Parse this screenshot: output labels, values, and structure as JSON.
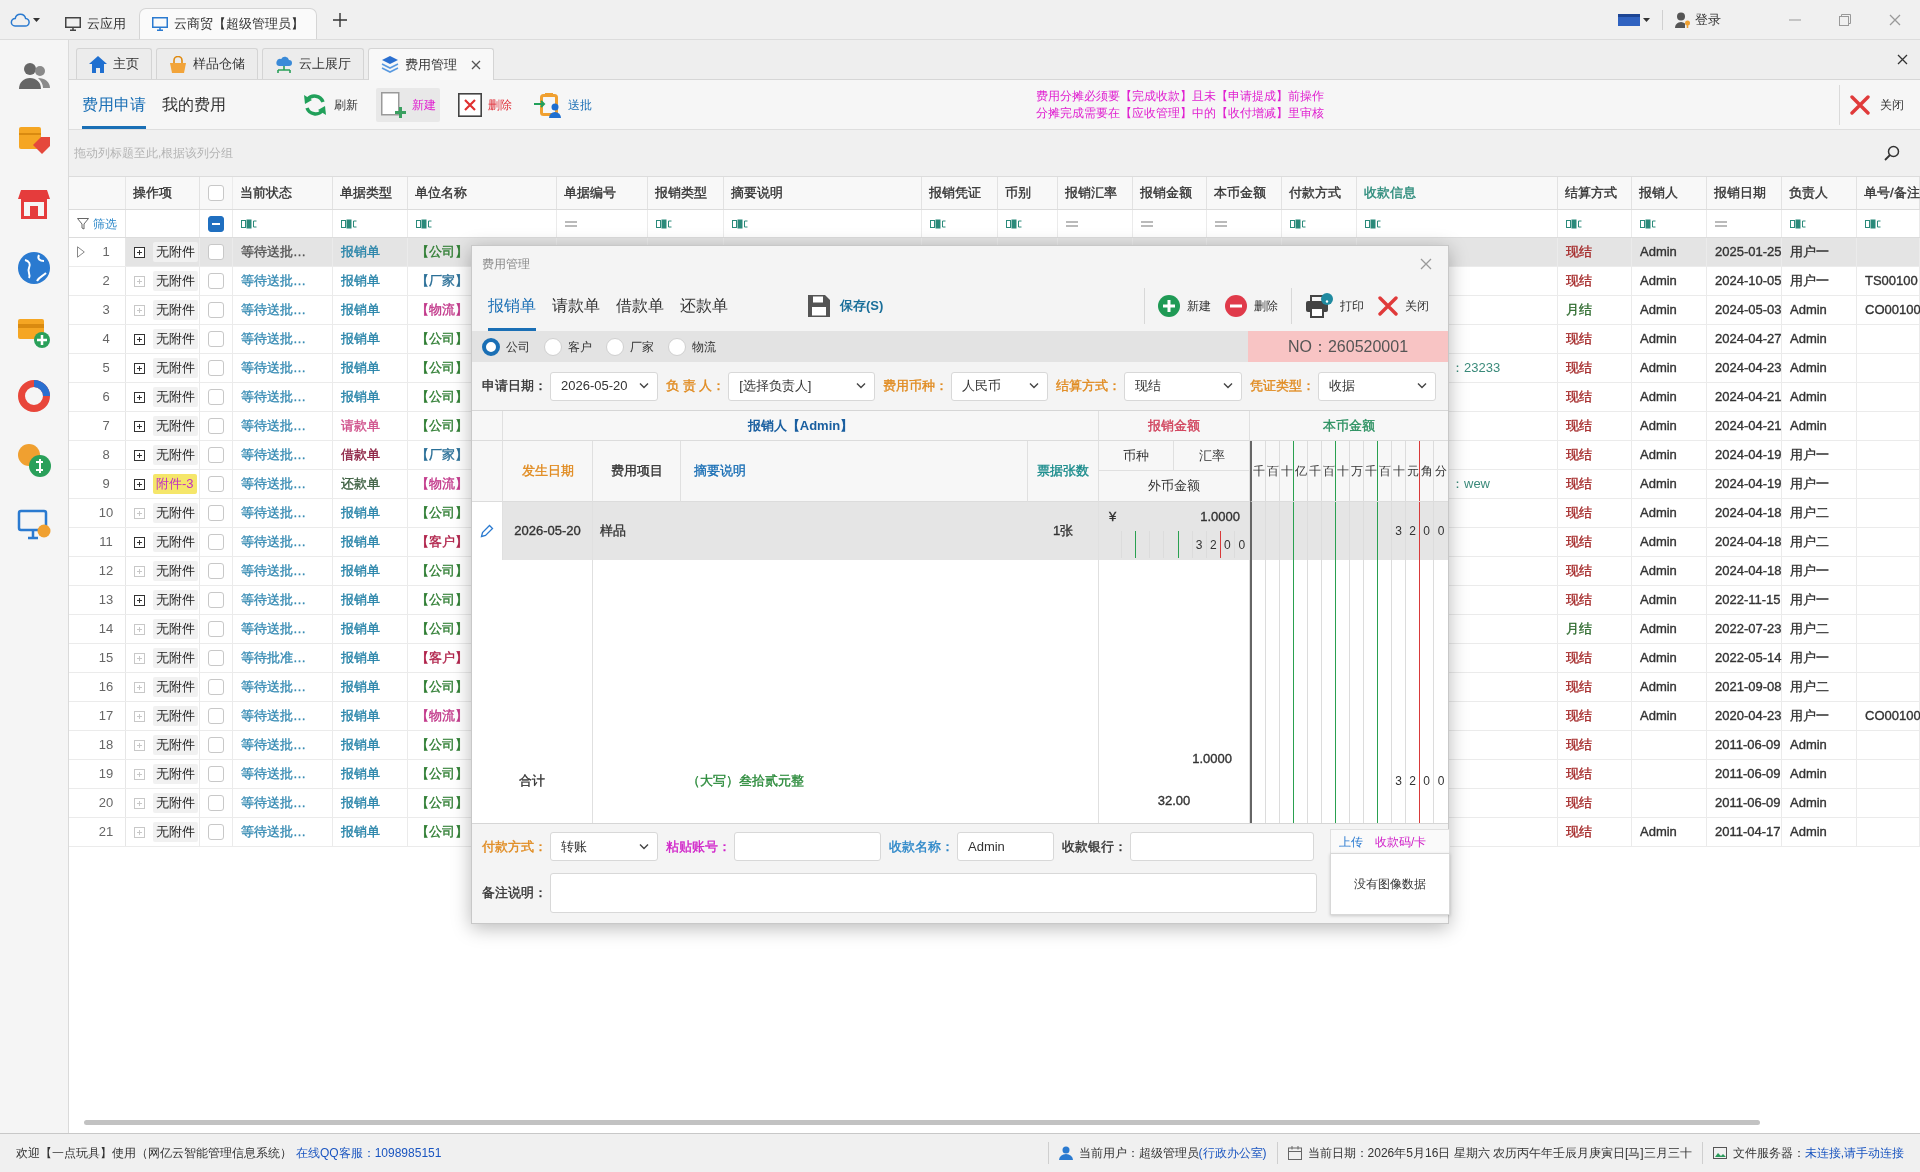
{
  "titlebar": {
    "tabs": [
      {
        "label": "云应用",
        "selected": false
      },
      {
        "label": "云商贸【超级管理员】",
        "selected": true
      }
    ],
    "login": "登录"
  },
  "module_tabs": [
    {
      "kind": "home",
      "label": "主页",
      "selected": false
    },
    {
      "kind": "warehouse",
      "label": "样品仓储",
      "selected": false
    },
    {
      "kind": "showroom",
      "label": "云上展厅",
      "selected": false
    },
    {
      "kind": "expense",
      "label": "费用管理",
      "selected": true
    }
  ],
  "toolbar": {
    "views": [
      {
        "label": "费用申请",
        "selected": true
      },
      {
        "label": "我的费用",
        "selected": false
      }
    ],
    "buttons": [
      {
        "kind": "refresh",
        "label": "刷新",
        "hovered": false
      },
      {
        "kind": "new",
        "label": "新建",
        "hovered": true
      },
      {
        "kind": "delete",
        "label": "删除",
        "hovered": false
      },
      {
        "kind": "submit",
        "label": "送批",
        "hovered": false
      }
    ],
    "notice": [
      "费用分摊必须要【完成收款】且未【申请提成】前操作",
      "分摊完成需要在【应收管理】中的【收付增减】里审核"
    ],
    "close": "关闭"
  },
  "table": {
    "group_hint": "拖动列标题至此,根据该列分组",
    "filter_label": "筛选",
    "select_all": {
      "checked": false
    },
    "filter_select": {
      "indeterminate": true
    },
    "columns": [
      {
        "label": "操作项"
      },
      {
        "label": "当前状态",
        "kind": "text"
      },
      {
        "label": "单据类型",
        "kind": "text"
      },
      {
        "label": "单位名称",
        "kind": "text"
      },
      {
        "label": "单据编号",
        "kind": "equals"
      },
      {
        "label": "报销类型",
        "kind": "text"
      },
      {
        "label": "摘要说明",
        "kind": "text"
      },
      {
        "label": "报销凭证",
        "kind": "text"
      },
      {
        "label": "币别",
        "kind": "text"
      },
      {
        "label": "报销汇率",
        "kind": "equals"
      },
      {
        "label": "报销金额",
        "kind": "equals"
      },
      {
        "label": "本币金额",
        "kind": "equals"
      },
      {
        "label": "付款方式",
        "kind": "text"
      },
      {
        "label": "收款信息",
        "kind": "text",
        "color": "#2a8a7a"
      },
      {
        "label": "结算方式",
        "kind": "text"
      },
      {
        "label": "报销人",
        "kind": "text"
      },
      {
        "label": "报销日期",
        "kind": "equals"
      },
      {
        "label": "负责人",
        "kind": "text"
      },
      {
        "label": "单号/备注",
        "kind": "text"
      }
    ],
    "rows": [
      {
        "no": "1",
        "selected": true,
        "expandable": true,
        "checked": false,
        "attachment": {
          "text": "无附件",
          "highlighted": false
        },
        "status": "等待送批…",
        "doc_type": {
          "text": "报销单",
          "color": "#2683a8"
        },
        "party": {
          "text": "【公司】",
          "color": "#2e7d32"
        },
        "settlement": {
          "text": "现结",
          "color": "#a52a2a"
        },
        "claimant": "Admin",
        "date": "2025-01-25",
        "owner": "用户一"
      },
      {
        "no": "2",
        "selected": false,
        "expandable": false,
        "checked": false,
        "attachment": {
          "text": "无附件",
          "highlighted": false
        },
        "status": "等待送批…",
        "doc_type": {
          "text": "报销单",
          "color": "#2683a8"
        },
        "party": {
          "text": "【厂家】",
          "color": "#2a6f97"
        },
        "settlement": {
          "text": "现结",
          "color": "#a52a2a"
        },
        "claimant": "Admin",
        "date": "2024-10-05",
        "owner": "用户一",
        "ref": "TS00100"
      },
      {
        "no": "3",
        "selected": false,
        "expandable": false,
        "checked": false,
        "attachment": {
          "text": "无附件",
          "highlighted": false
        },
        "status": "等待送批…",
        "doc_type": {
          "text": "报销单",
          "color": "#2683a8"
        },
        "party": {
          "text": "【物流】",
          "color": "#c2388a"
        },
        "settlement": {
          "text": "月结",
          "color": "#2f6b2f"
        },
        "claimant": "Admin",
        "date": "2024-05-03",
        "owner": "Admin",
        "ref": "CO00100"
      },
      {
        "no": "4",
        "selected": false,
        "expandable": true,
        "checked": false,
        "attachment": {
          "text": "无附件",
          "highlighted": false
        },
        "status": "等待送批…",
        "doc_type": {
          "text": "报销单",
          "color": "#2683a8"
        },
        "party": {
          "text": "【公司】",
          "color": "#2e7d32"
        },
        "settlement": {
          "text": "现结",
          "color": "#a52a2a"
        },
        "claimant": "Admin",
        "date": "2024-04-27",
        "owner": "Admin"
      },
      {
        "no": "5",
        "selected": false,
        "expandable": true,
        "checked": false,
        "attachment": {
          "text": "无附件",
          "highlighted": false
        },
        "status": "等待送批…",
        "doc_type": {
          "text": "报销单",
          "color": "#2683a8"
        },
        "party": {
          "text": "【公司】",
          "color": "#2e7d32"
        },
        "receipt_info": "：23233",
        "settlement": {
          "text": "现结",
          "color": "#a52a2a"
        },
        "claimant": "Admin",
        "date": "2024-04-23",
        "owner": "Admin"
      },
      {
        "no": "6",
        "selected": false,
        "expandable": true,
        "checked": false,
        "attachment": {
          "text": "无附件",
          "highlighted": false
        },
        "status": "等待送批…",
        "doc_type": {
          "text": "报销单",
          "color": "#2683a8"
        },
        "party": {
          "text": "【公司】",
          "color": "#2e7d32"
        },
        "settlement": {
          "text": "现结",
          "color": "#a52a2a"
        },
        "claimant": "Admin",
        "date": "2024-04-21",
        "owner": "Admin"
      },
      {
        "no": "7",
        "selected": false,
        "expandable": true,
        "checked": false,
        "attachment": {
          "text": "无附件",
          "highlighted": false
        },
        "status": "等待送批…",
        "doc_type": {
          "text": "请款单",
          "color": "#cf4f8a"
        },
        "party": {
          "text": "【公司】",
          "color": "#2e7d32"
        },
        "settlement": {
          "text": "现结",
          "color": "#a52a2a"
        },
        "claimant": "Admin",
        "date": "2024-04-21",
        "owner": "Admin"
      },
      {
        "no": "8",
        "selected": false,
        "expandable": true,
        "checked": false,
        "attachment": {
          "text": "无附件",
          "highlighted": false
        },
        "status": "等待送批…",
        "doc_type": {
          "text": "借款单",
          "color": "#8a1d3f"
        },
        "party": {
          "text": "【厂家】",
          "color": "#2a6f97"
        },
        "settlement": {
          "text": "现结",
          "color": "#a52a2a"
        },
        "claimant": "Admin",
        "date": "2024-04-19",
        "owner": "用户一"
      },
      {
        "no": "9",
        "selected": false,
        "expandable": true,
        "checked": false,
        "attachment": {
          "text": "附件-3",
          "highlighted": true
        },
        "status": "等待送批…",
        "doc_type": {
          "text": "还款单",
          "color": "#3b5e3f"
        },
        "party": {
          "text": "【物流】",
          "color": "#c2388a"
        },
        "receipt_info": "：wew",
        "settlement": {
          "text": "现结",
          "color": "#a52a2a"
        },
        "claimant": "Admin",
        "date": "2024-04-19",
        "owner": "用户一"
      },
      {
        "no": "10",
        "selected": false,
        "expandable": false,
        "checked": false,
        "attachment": {
          "text": "无附件",
          "highlighted": false
        },
        "status": "等待送批…",
        "doc_type": {
          "text": "报销单",
          "color": "#2683a8"
        },
        "party": {
          "text": "【公司】",
          "color": "#2e7d32"
        },
        "settlement": {
          "text": "现结",
          "color": "#a52a2a"
        },
        "claimant": "Admin",
        "date": "2024-04-18",
        "owner": "用户二"
      },
      {
        "no": "11",
        "selected": false,
        "expandable": true,
        "checked": false,
        "attachment": {
          "text": "无附件",
          "highlighted": false
        },
        "status": "等待送批…",
        "doc_type": {
          "text": "报销单",
          "color": "#2683a8"
        },
        "party": {
          "text": "【客户】",
          "color": "#b0224a"
        },
        "settlement": {
          "text": "现结",
          "color": "#a52a2a"
        },
        "claimant": "Admin",
        "date": "2024-04-18",
        "owner": "用户二"
      },
      {
        "no": "12",
        "selected": false,
        "expandable": false,
        "checked": false,
        "attachment": {
          "text": "无附件",
          "highlighted": false
        },
        "status": "等待送批…",
        "doc_type": {
          "text": "报销单",
          "color": "#2683a8"
        },
        "party": {
          "text": "【公司】",
          "color": "#2e7d32"
        },
        "settlement": {
          "text": "现结",
          "color": "#a52a2a"
        },
        "claimant": "Admin",
        "date": "2024-04-18",
        "owner": "用户一"
      },
      {
        "no": "13",
        "selected": false,
        "expandable": true,
        "checked": false,
        "attachment": {
          "text": "无附件",
          "highlighted": false
        },
        "status": "等待送批…",
        "doc_type": {
          "text": "报销单",
          "color": "#2683a8"
        },
        "party": {
          "text": "【公司】",
          "color": "#2e7d32"
        },
        "settlement": {
          "text": "现结",
          "color": "#a52a2a"
        },
        "claimant": "Admin",
        "date": "2022-11-15",
        "owner": "用户一"
      },
      {
        "no": "14",
        "selected": false,
        "expandable": false,
        "checked": false,
        "attachment": {
          "text": "无附件",
          "highlighted": false
        },
        "status": "等待送批…",
        "doc_type": {
          "text": "报销单",
          "color": "#2683a8"
        },
        "party": {
          "text": "【公司】",
          "color": "#2e7d32"
        },
        "settlement": {
          "text": "月结",
          "color": "#2f6b2f"
        },
        "claimant": "Admin",
        "date": "2022-07-23",
        "owner": "用户二"
      },
      {
        "no": "15",
        "selected": false,
        "expandable": false,
        "checked": false,
        "attachment": {
          "text": "无附件",
          "highlighted": false
        },
        "status": "等待批准…",
        "doc_type": {
          "text": "报销单",
          "color": "#2683a8"
        },
        "party": {
          "text": "【客户】",
          "color": "#b0224a"
        },
        "settlement": {
          "text": "现结",
          "color": "#a52a2a"
        },
        "claimant": "Admin",
        "date": "2022-05-14",
        "owner": "用户一"
      },
      {
        "no": "16",
        "selected": false,
        "expandable": false,
        "checked": false,
        "attachment": {
          "text": "无附件",
          "highlighted": false
        },
        "status": "等待送批…",
        "doc_type": {
          "text": "报销单",
          "color": "#2683a8"
        },
        "party": {
          "text": "【公司】",
          "color": "#2e7d32"
        },
        "settlement": {
          "text": "现结",
          "color": "#a52a2a"
        },
        "claimant": "Admin",
        "date": "2021-09-08",
        "owner": "用户二"
      },
      {
        "no": "17",
        "selected": false,
        "expandable": false,
        "checked": false,
        "attachment": {
          "text": "无附件",
          "highlighted": false
        },
        "status": "等待送批…",
        "doc_type": {
          "text": "报销单",
          "color": "#2683a8"
        },
        "party": {
          "text": "【物流】",
          "color": "#c2388a"
        },
        "settlement": {
          "text": "现结",
          "color": "#a52a2a"
        },
        "claimant": "Admin",
        "date": "2020-04-23",
        "owner": "用户一",
        "ref": "CO00100"
      },
      {
        "no": "18",
        "selected": false,
        "expandable": false,
        "checked": false,
        "attachment": {
          "text": "无附件",
          "highlighted": false
        },
        "status": "等待送批…",
        "doc_type": {
          "text": "报销单",
          "color": "#2683a8"
        },
        "party": {
          "text": "【公司】",
          "color": "#2e7d32"
        },
        "settlement": {
          "text": "现结",
          "color": "#a52a2a"
        },
        "date": "2011-06-09",
        "owner": "Admin"
      },
      {
        "no": "19",
        "selected": false,
        "expandable": false,
        "checked": false,
        "attachment": {
          "text": "无附件",
          "highlighted": false
        },
        "status": "等待送批…",
        "doc_type": {
          "text": "报销单",
          "color": "#2683a8"
        },
        "party": {
          "text": "【公司】",
          "color": "#2e7d32"
        },
        "settlement": {
          "text": "现结",
          "color": "#a52a2a"
        },
        "date": "2011-06-09",
        "owner": "Admin"
      },
      {
        "no": "20",
        "selected": false,
        "expandable": false,
        "checked": false,
        "attachment": {
          "text": "无附件",
          "highlighted": false
        },
        "status": "等待送批…",
        "doc_type": {
          "text": "报销单",
          "color": "#2683a8"
        },
        "party": {
          "text": "【公司】",
          "color": "#2e7d32"
        },
        "settlement": {
          "text": "现结",
          "color": "#a52a2a"
        },
        "date": "2011-06-09",
        "owner": "Admin"
      },
      {
        "no": "21",
        "selected": false,
        "expandable": false,
        "checked": false,
        "attachment": {
          "text": "无附件",
          "highlighted": false
        },
        "status": "等待送批…",
        "doc_type": {
          "text": "报销单",
          "color": "#2683a8"
        },
        "party": {
          "text": "【公司】",
          "color": "#2e7d32"
        },
        "settlement": {
          "text": "现结",
          "color": "#a52a2a"
        },
        "claimant": "Admin",
        "date": "2011-04-17",
        "owner": "Admin"
      }
    ]
  },
  "dialog": {
    "title": "费用管理",
    "tabs": [
      {
        "label": "报销单",
        "selected": true
      },
      {
        "label": "请款单",
        "selected": false
      },
      {
        "label": "借款单",
        "selected": false
      },
      {
        "label": "还款单",
        "selected": false
      }
    ],
    "save": "保存(S)",
    "actions": [
      {
        "kind": "new",
        "label": "新建"
      },
      {
        "kind": "delete",
        "label": "删除"
      },
      {
        "kind": "print",
        "label": "打印"
      },
      {
        "kind": "close",
        "label": "关闭"
      }
    ],
    "party_types": [
      {
        "label": "公司",
        "selected": true
      },
      {
        "label": "客户",
        "selected": false
      },
      {
        "label": "厂家",
        "selected": false
      },
      {
        "label": "物流",
        "selected": false
      }
    ],
    "doc_no": "NO：260520001",
    "fields": [
      {
        "kind": "select",
        "label": "申请日期：",
        "value": "2026-05-20",
        "color": "#333333"
      },
      {
        "kind": "select",
        "label": "负 责 人：",
        "value": "[选择负责人]",
        "color": "#e08a1e"
      },
      {
        "kind": "select",
        "label": "费用币种：",
        "value": "人民币",
        "color": "#e08a1e"
      },
      {
        "kind": "select",
        "label": "结算方式：",
        "value": "现结",
        "color": "#e08a1e"
      },
      {
        "kind": "select",
        "label": "凭证类型：",
        "value": "收据",
        "color": "#e08a1e"
      }
    ],
    "grid": {
      "claimant": "报销人【Admin】",
      "amount_header": "报销金额",
      "base_header": "本币金额",
      "columns": [
        {
          "label": "发生日期",
          "color": "#e08a1e"
        },
        {
          "label": "费用项目",
          "color": "#333333"
        },
        {
          "label": "摘要说明",
          "color": "#1a6fb5"
        },
        {
          "label": "票据张数",
          "color": "#178a8a"
        }
      ],
      "currency_header": "币种",
      "rate_header": "汇率",
      "foreign_header": "外币金额",
      "places": [
        "千",
        "百",
        "十",
        "亿",
        "千",
        "百",
        "十",
        "万",
        "千",
        "百",
        "十",
        "元",
        "角",
        "分"
      ],
      "rows": [
        {
          "selected": true,
          "editing": true,
          "date": "2026-05-20",
          "item": "样品",
          "count": "1张",
          "symbol": "¥",
          "rate": "1.0000",
          "foreign_digits": [
            "3",
            "2",
            "0",
            "0"
          ],
          "base_digits": [
            "3",
            "2",
            "0",
            "0"
          ]
        }
      ],
      "total": {
        "label": "合计",
        "in_words": "（大写）叁拾贰元整",
        "rate": "1.0000",
        "amount": "32.00",
        "base_digits": [
          "3",
          "2",
          "0",
          "0"
        ]
      }
    },
    "payment_fields": [
      {
        "kind": "select",
        "label": "付款方式：",
        "value": "转账",
        "color": "#e08a1e"
      },
      {
        "kind": "input",
        "label": "粘贴账号：",
        "color": "#d020c8"
      },
      {
        "kind": "input",
        "label": "收款名称：",
        "value": "Admin",
        "color": "#2a86c8"
      },
      {
        "kind": "input",
        "label": "收款银行：",
        "color": "#333333"
      }
    ],
    "remark_label": "备注说明：",
    "image_panel": {
      "upload": "上传",
      "qr": "收款码/卡",
      "empty": "没有图像数据"
    }
  },
  "status_bar": {
    "welcome": "欢迎【一点玩具】使用（网亿云智能管理信息系统）",
    "support": "在线QQ客服：1098985151",
    "user": "当前用户：超级管理员",
    "user_dept": "(行政办公室)",
    "date": "当前日期：2026年5月16日 星期六 农历丙午年壬辰月庚寅日[马]三月三十",
    "server": "文件服务器：",
    "server_status": "未连接,请手动连接"
  }
}
